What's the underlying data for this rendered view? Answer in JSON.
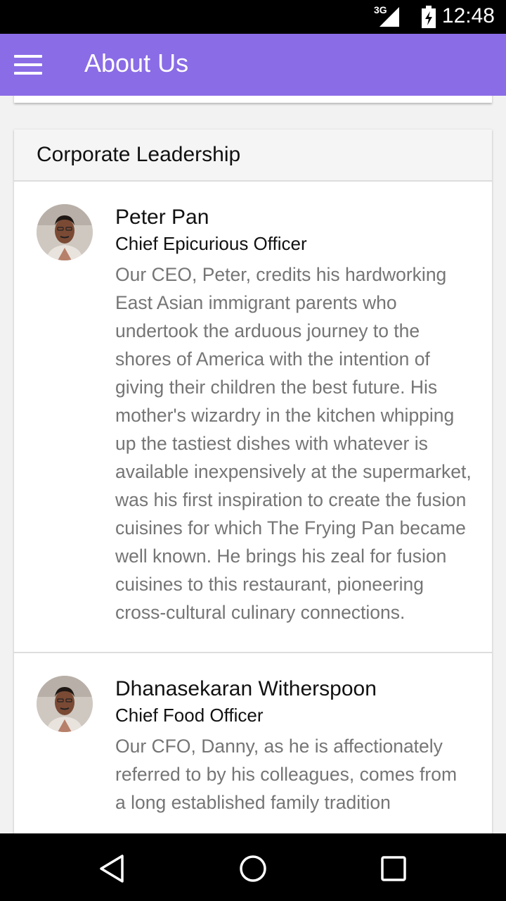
{
  "status_bar": {
    "network": "3G",
    "time": "12:48",
    "icons": [
      "signal-icon",
      "battery-icon"
    ]
  },
  "toolbar": {
    "title": "About Us",
    "menu_icon": "hamburger-menu-icon"
  },
  "leadership": {
    "header": "Corporate Leadership",
    "leaders": [
      {
        "name": "Peter Pan",
        "role": "Chief Epicurious Officer",
        "bio": "Our CEO, Peter, credits his hardworking East Asian immigrant parents who undertook the arduous journey to the shores of America with the intention of giving their children the best future. His mother's wizardry in the kitchen whipping up the tastiest dishes with whatever is available inexpensively at the supermarket, was his first inspiration to create the fusion cuisines for which The Frying Pan became well known. He brings his zeal for fusion cuisines to this restaurant, pioneering cross-cultural culinary connections."
      },
      {
        "name": "Dhanasekaran Witherspoon",
        "role": "Chief Food Officer",
        "bio": "Our CFO, Danny, as he is affectionately referred to by his colleagues, comes from a long established family tradition"
      }
    ]
  },
  "nav_bar": {
    "icons": [
      "back-icon",
      "home-icon",
      "recents-icon"
    ]
  },
  "colors": {
    "toolbar": "#8a6ce6",
    "status_bar": "#000000",
    "bio_text": "#757575"
  }
}
